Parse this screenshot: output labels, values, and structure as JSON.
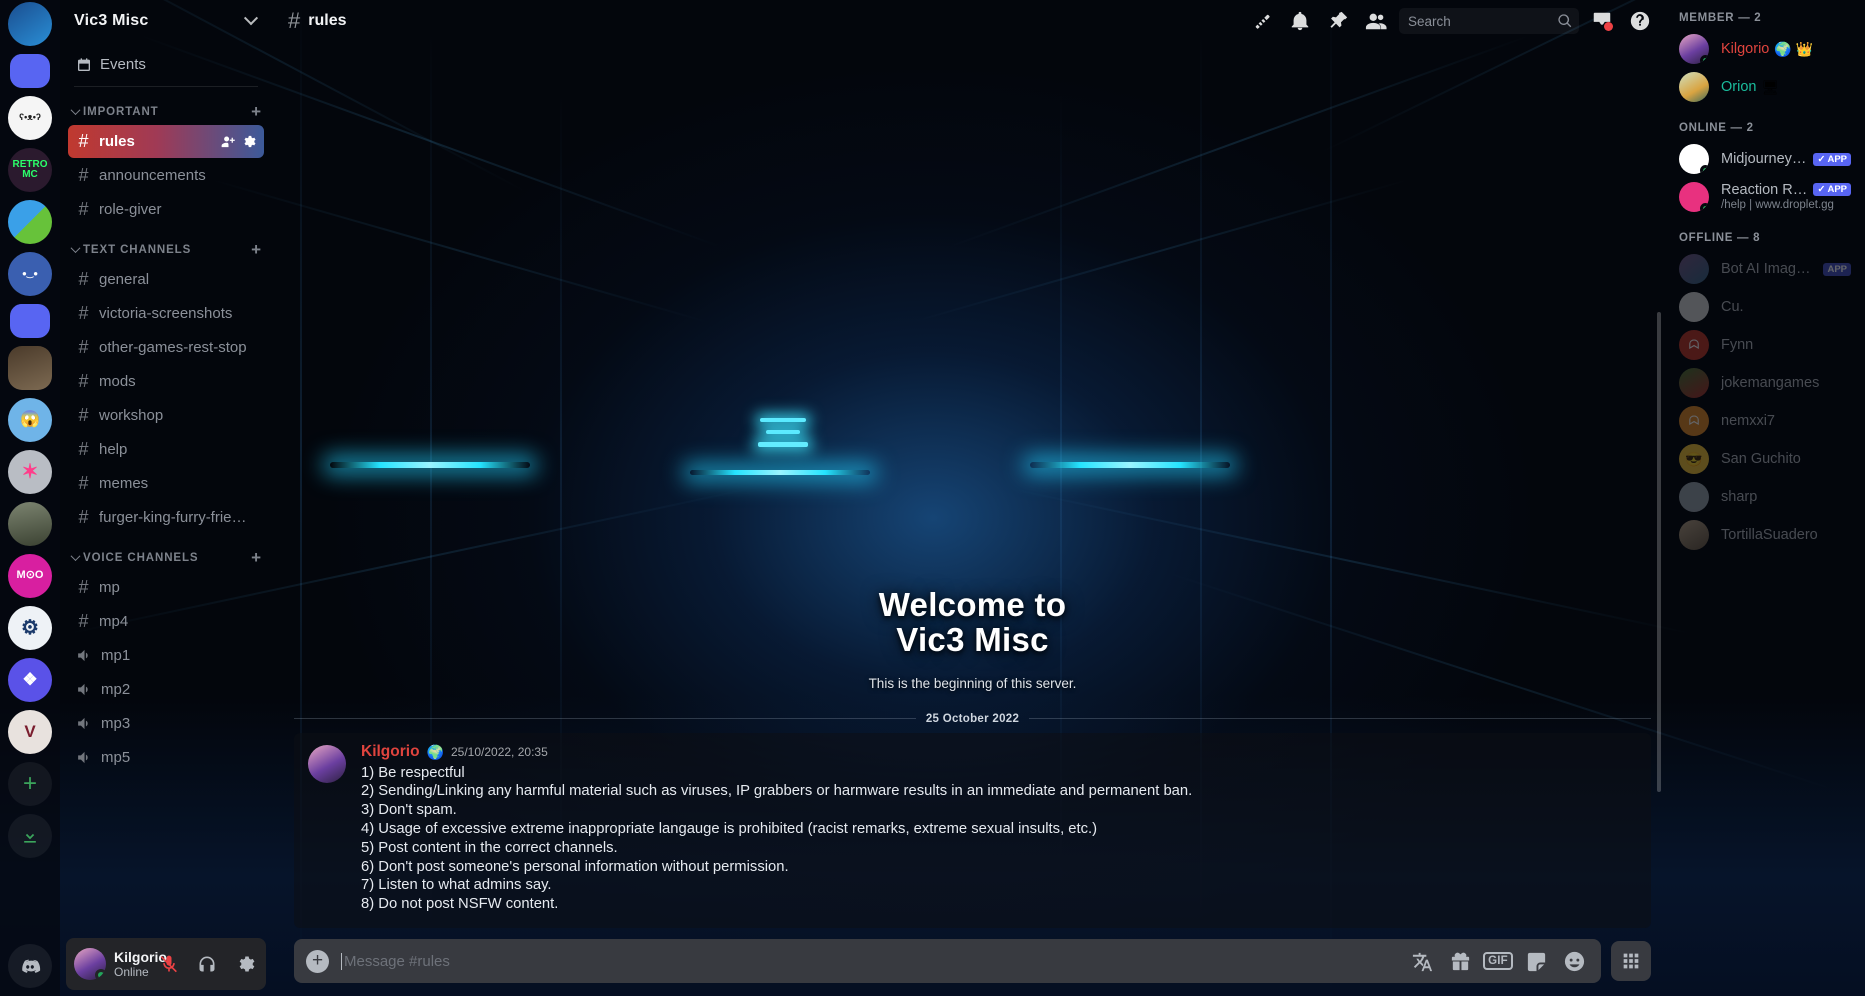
{
  "window": {
    "title": "Discord"
  },
  "server": {
    "name": "Vic3 Misc",
    "dropdown_icon": "chevron-down-icon"
  },
  "sidebar": {
    "events": {
      "label": "Events",
      "icon": "calendar-icon"
    },
    "categories": [
      {
        "name": "IMPORTANT",
        "add_label": "+",
        "channels": [
          {
            "name": "rules",
            "type": "text",
            "active": true
          },
          {
            "name": "announcements",
            "type": "text",
            "active": false
          },
          {
            "name": "role-giver",
            "type": "text",
            "active": false
          }
        ]
      },
      {
        "name": "TEXT CHANNELS",
        "add_label": "+",
        "channels": [
          {
            "name": "general",
            "type": "text",
            "active": false
          },
          {
            "name": "victoria-screenshots",
            "type": "text",
            "active": false
          },
          {
            "name": "other-games-rest-stop",
            "type": "text",
            "active": false
          },
          {
            "name": "mods",
            "type": "text",
            "active": false
          },
          {
            "name": "workshop",
            "type": "text",
            "active": false
          },
          {
            "name": "help",
            "type": "text",
            "active": false
          },
          {
            "name": "memes",
            "type": "text",
            "active": false
          },
          {
            "name": "furger-king-furry-frie…",
            "type": "text",
            "active": false
          }
        ]
      },
      {
        "name": "VOICE CHANNELS",
        "add_label": "+",
        "channels": [
          {
            "name": "mp",
            "type": "text",
            "active": false
          },
          {
            "name": "mp4",
            "type": "text",
            "active": false
          },
          {
            "name": "mp1",
            "type": "voice",
            "active": false
          },
          {
            "name": "mp2",
            "type": "voice",
            "active": false
          },
          {
            "name": "mp3",
            "type": "voice",
            "active": false
          },
          {
            "name": "mp5",
            "type": "voice",
            "active": false
          }
        ]
      }
    ]
  },
  "user_panel": {
    "name": "Kilgorio",
    "status": "Online",
    "mic_icon": "microphone-muted-icon",
    "headset_icon": "headphones-icon",
    "settings_icon": "gear-icon"
  },
  "topbar": {
    "hash": "#",
    "channel": "rules",
    "icons": [
      "threads-icon",
      "bell-icon",
      "pin-icon",
      "members-icon"
    ],
    "search": {
      "placeholder": "Search",
      "icon": "search-icon"
    },
    "inbox_icon": "inbox-icon",
    "help_icon": "help-circle-icon"
  },
  "welcome": {
    "title_line1": "Welcome to",
    "title_line2": "Vic3 Misc",
    "subtitle": "This is the beginning of this server."
  },
  "date_separator": "25 October 2022",
  "message": {
    "author": "Kilgorio",
    "author_color": "#e0443e",
    "badge_icon": "globe-icon",
    "timestamp": "25/10/2022, 20:35",
    "lines": [
      "1) Be respectful",
      "2) Sending/Linking any harmful material such as viruses, IP grabbers or harmware results in an immediate and permanent ban.",
      "3) Don't spam.",
      "4) Usage of excessive extreme inappropriate langauge is prohibited (racist remarks, extreme sexual insults, etc.)",
      "5) Post content in the correct channels.",
      "6) Don't post someone's personal information without permission.",
      "7) Listen to what admins say.",
      "8) Do not post NSFW content."
    ]
  },
  "composer": {
    "placeholder": "Message #rules",
    "attach_icon": "plus-circle-icon",
    "icons": [
      "translate-icon",
      "gift-icon",
      "gif-icon",
      "sticker-icon",
      "emoji-icon"
    ],
    "gif_label": "GIF",
    "apps_icon": "apps-grid-icon"
  },
  "members": {
    "groups": [
      {
        "title": "MEMBER — 2",
        "entries": [
          {
            "name": "Kilgorio",
            "color": "#e0443e",
            "status": "online",
            "emojis": "🌍 👑",
            "sub": "",
            "badge": "",
            "offline": false
          },
          {
            "name": "Orion",
            "color": "#1abc9c",
            "status": "",
            "emojis": "🖥",
            "sub": "",
            "badge": "",
            "offline": false
          }
        ]
      },
      {
        "title": "ONLINE — 2",
        "entries": [
          {
            "name": "Midjourney B…",
            "color": "#b5bac1",
            "status": "online",
            "emojis": "",
            "sub": "",
            "badge": "APP",
            "offline": false
          },
          {
            "name": "Reaction Rol…",
            "color": "#b5bac1",
            "status": "online",
            "emojis": "",
            "sub": "/help | www.droplet.gg",
            "badge": "APP",
            "offline": false
          }
        ]
      },
      {
        "title": "OFFLINE — 8",
        "entries": [
          {
            "name": "Bot AI Image Th…",
            "color": "#b5bac1",
            "status": "",
            "emojis": "",
            "sub": "",
            "badge": "APP",
            "offline": true
          },
          {
            "name": "Cu.",
            "color": "#b5bac1",
            "status": "",
            "emojis": "",
            "sub": "",
            "badge": "",
            "offline": true
          },
          {
            "name": "Fynn",
            "color": "#b5bac1",
            "status": "",
            "emojis": "",
            "sub": "",
            "badge": "",
            "offline": true
          },
          {
            "name": "jokemangames",
            "color": "#b5bac1",
            "status": "",
            "emojis": "",
            "sub": "",
            "badge": "",
            "offline": true
          },
          {
            "name": "nemxxi7",
            "color": "#b5bac1",
            "status": "",
            "emojis": "",
            "sub": "",
            "badge": "",
            "offline": true
          },
          {
            "name": "San Guchito",
            "color": "#b5bac1",
            "status": "",
            "emojis": "",
            "sub": "",
            "badge": "",
            "offline": true
          },
          {
            "name": "sharp",
            "color": "#b5bac1",
            "status": "",
            "emojis": "",
            "sub": "",
            "badge": "",
            "offline": true
          },
          {
            "name": "TortillaSuadero",
            "color": "#b5bac1",
            "status": "",
            "emojis": "",
            "sub": "",
            "badge": "",
            "offline": true
          }
        ]
      }
    ]
  },
  "rail": {
    "add_server_label": "+",
    "download_icon": "download-icon",
    "home_icon": "discord-home-icon"
  },
  "colors": {
    "accent": "#5865f2",
    "online": "#23a55a",
    "active_channel_start": "#c0392f",
    "active_channel_end": "#3c5a9a"
  }
}
